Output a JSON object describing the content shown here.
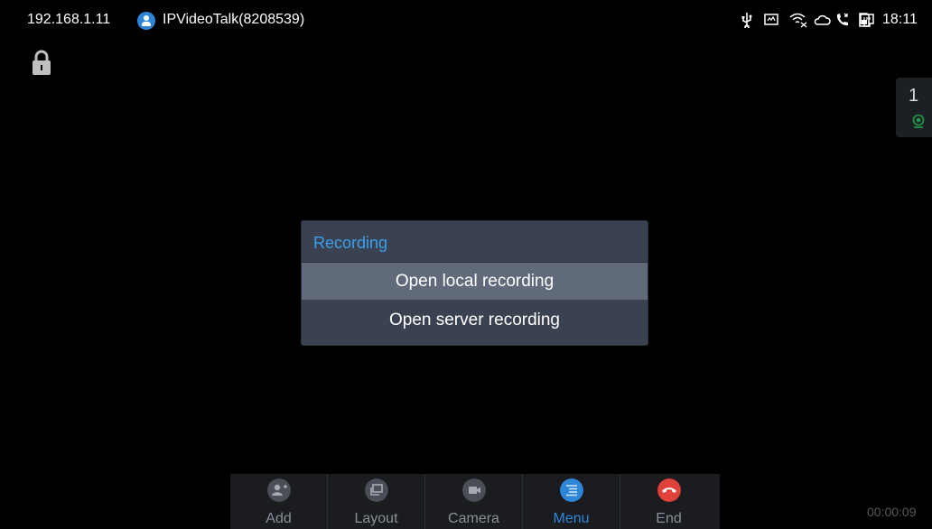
{
  "status_bar": {
    "ip_address": "192.168.1.11",
    "account_name": "IPVideoTalk(8208539)",
    "clock": "18:11",
    "icons": [
      "account-icon",
      "usb-icon",
      "screen-icon",
      "wifi-off-icon",
      "cloud-icon",
      "call-icon",
      "sd-card-icon",
      "network-icon"
    ]
  },
  "side_indicator": {
    "count": "1"
  },
  "dialog": {
    "title": "Recording",
    "options": [
      {
        "label": "Open local recording",
        "selected": true
      },
      {
        "label": "Open server recording",
        "selected": false
      }
    ]
  },
  "toolbar": {
    "buttons": [
      {
        "label": "Add",
        "icon": "add-user-icon",
        "active": false
      },
      {
        "label": "Layout",
        "icon": "layout-icon",
        "active": false
      },
      {
        "label": "Camera",
        "icon": "camera-icon",
        "active": false
      },
      {
        "label": "Menu",
        "icon": "menu-icon",
        "active": true
      },
      {
        "label": "End",
        "icon": "end-call-icon",
        "active": false
      }
    ]
  },
  "call_timer": "00:00:09",
  "colors": {
    "accent": "#3aa0ea",
    "dialog_bg": "#3a4150",
    "selected_option_bg": "#616a7a",
    "end_call": "#e0413b"
  }
}
